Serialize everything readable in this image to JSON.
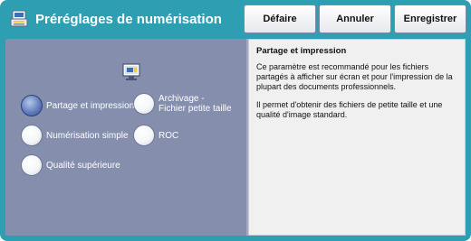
{
  "header": {
    "title": "Préréglages de numérisation",
    "undo_label": "Défaire",
    "cancel_label": "Annuler",
    "save_label": "Enregistrer"
  },
  "options": [
    {
      "label": "Partage et impression",
      "selected": true
    },
    {
      "label": "Archivage - Fichier petite taille",
      "selected": false
    },
    {
      "label": "Numérisation simple",
      "selected": false
    },
    {
      "label": "ROC",
      "selected": false
    },
    {
      "label": "Qualité supérieure",
      "selected": false
    }
  ],
  "info": {
    "title": "Partage et impression",
    "paragraph1": "Ce paramètre est recommandé pour les fichiers partagés à afficher sur écran et pour l'impression de la plupart des documents professionnels.",
    "paragraph2": "Il permet d'obtenir des fichiers de petite taille et une qualité d'image standard."
  },
  "colors": {
    "frame": "#2e9eb3",
    "left_panel": "#858fad",
    "info_panel": "#f0f0f0",
    "selected_radio": "#5c79b8"
  },
  "icons": {
    "title_icon": "scan-preset-icon",
    "scan_icon": "monitor-icon"
  }
}
